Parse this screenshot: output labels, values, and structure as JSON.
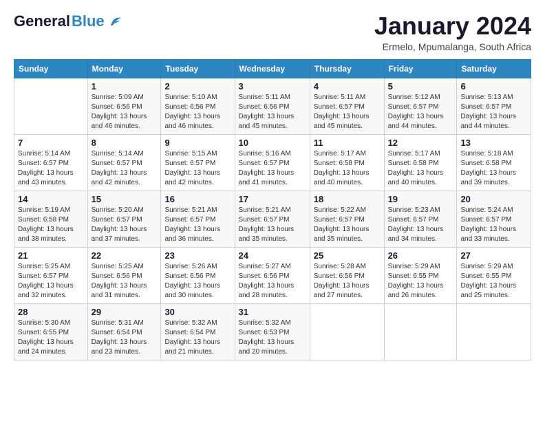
{
  "logo": {
    "general": "General",
    "blue": "Blue"
  },
  "header": {
    "month_title": "January 2024",
    "location": "Ermelo, Mpumalanga, South Africa"
  },
  "weekdays": [
    "Sunday",
    "Monday",
    "Tuesday",
    "Wednesday",
    "Thursday",
    "Friday",
    "Saturday"
  ],
  "weeks": [
    [
      {
        "day": "",
        "sunrise": "",
        "sunset": "",
        "daylight": ""
      },
      {
        "day": "1",
        "sunrise": "Sunrise: 5:09 AM",
        "sunset": "Sunset: 6:56 PM",
        "daylight": "Daylight: 13 hours and 46 minutes."
      },
      {
        "day": "2",
        "sunrise": "Sunrise: 5:10 AM",
        "sunset": "Sunset: 6:56 PM",
        "daylight": "Daylight: 13 hours and 46 minutes."
      },
      {
        "day": "3",
        "sunrise": "Sunrise: 5:11 AM",
        "sunset": "Sunset: 6:56 PM",
        "daylight": "Daylight: 13 hours and 45 minutes."
      },
      {
        "day": "4",
        "sunrise": "Sunrise: 5:11 AM",
        "sunset": "Sunset: 6:57 PM",
        "daylight": "Daylight: 13 hours and 45 minutes."
      },
      {
        "day": "5",
        "sunrise": "Sunrise: 5:12 AM",
        "sunset": "Sunset: 6:57 PM",
        "daylight": "Daylight: 13 hours and 44 minutes."
      },
      {
        "day": "6",
        "sunrise": "Sunrise: 5:13 AM",
        "sunset": "Sunset: 6:57 PM",
        "daylight": "Daylight: 13 hours and 44 minutes."
      }
    ],
    [
      {
        "day": "7",
        "sunrise": "Sunrise: 5:14 AM",
        "sunset": "Sunset: 6:57 PM",
        "daylight": "Daylight: 13 hours and 43 minutes."
      },
      {
        "day": "8",
        "sunrise": "Sunrise: 5:14 AM",
        "sunset": "Sunset: 6:57 PM",
        "daylight": "Daylight: 13 hours and 42 minutes."
      },
      {
        "day": "9",
        "sunrise": "Sunrise: 5:15 AM",
        "sunset": "Sunset: 6:57 PM",
        "daylight": "Daylight: 13 hours and 42 minutes."
      },
      {
        "day": "10",
        "sunrise": "Sunrise: 5:16 AM",
        "sunset": "Sunset: 6:57 PM",
        "daylight": "Daylight: 13 hours and 41 minutes."
      },
      {
        "day": "11",
        "sunrise": "Sunrise: 5:17 AM",
        "sunset": "Sunset: 6:58 PM",
        "daylight": "Daylight: 13 hours and 40 minutes."
      },
      {
        "day": "12",
        "sunrise": "Sunrise: 5:17 AM",
        "sunset": "Sunset: 6:58 PM",
        "daylight": "Daylight: 13 hours and 40 minutes."
      },
      {
        "day": "13",
        "sunrise": "Sunrise: 5:18 AM",
        "sunset": "Sunset: 6:58 PM",
        "daylight": "Daylight: 13 hours and 39 minutes."
      }
    ],
    [
      {
        "day": "14",
        "sunrise": "Sunrise: 5:19 AM",
        "sunset": "Sunset: 6:58 PM",
        "daylight": "Daylight: 13 hours and 38 minutes."
      },
      {
        "day": "15",
        "sunrise": "Sunrise: 5:20 AM",
        "sunset": "Sunset: 6:57 PM",
        "daylight": "Daylight: 13 hours and 37 minutes."
      },
      {
        "day": "16",
        "sunrise": "Sunrise: 5:21 AM",
        "sunset": "Sunset: 6:57 PM",
        "daylight": "Daylight: 13 hours and 36 minutes."
      },
      {
        "day": "17",
        "sunrise": "Sunrise: 5:21 AM",
        "sunset": "Sunset: 6:57 PM",
        "daylight": "Daylight: 13 hours and 35 minutes."
      },
      {
        "day": "18",
        "sunrise": "Sunrise: 5:22 AM",
        "sunset": "Sunset: 6:57 PM",
        "daylight": "Daylight: 13 hours and 35 minutes."
      },
      {
        "day": "19",
        "sunrise": "Sunrise: 5:23 AM",
        "sunset": "Sunset: 6:57 PM",
        "daylight": "Daylight: 13 hours and 34 minutes."
      },
      {
        "day": "20",
        "sunrise": "Sunrise: 5:24 AM",
        "sunset": "Sunset: 6:57 PM",
        "daylight": "Daylight: 13 hours and 33 minutes."
      }
    ],
    [
      {
        "day": "21",
        "sunrise": "Sunrise: 5:25 AM",
        "sunset": "Sunset: 6:57 PM",
        "daylight": "Daylight: 13 hours and 32 minutes."
      },
      {
        "day": "22",
        "sunrise": "Sunrise: 5:25 AM",
        "sunset": "Sunset: 6:56 PM",
        "daylight": "Daylight: 13 hours and 31 minutes."
      },
      {
        "day": "23",
        "sunrise": "Sunrise: 5:26 AM",
        "sunset": "Sunset: 6:56 PM",
        "daylight": "Daylight: 13 hours and 30 minutes."
      },
      {
        "day": "24",
        "sunrise": "Sunrise: 5:27 AM",
        "sunset": "Sunset: 6:56 PM",
        "daylight": "Daylight: 13 hours and 28 minutes."
      },
      {
        "day": "25",
        "sunrise": "Sunrise: 5:28 AM",
        "sunset": "Sunset: 6:56 PM",
        "daylight": "Daylight: 13 hours and 27 minutes."
      },
      {
        "day": "26",
        "sunrise": "Sunrise: 5:29 AM",
        "sunset": "Sunset: 6:55 PM",
        "daylight": "Daylight: 13 hours and 26 minutes."
      },
      {
        "day": "27",
        "sunrise": "Sunrise: 5:29 AM",
        "sunset": "Sunset: 6:55 PM",
        "daylight": "Daylight: 13 hours and 25 minutes."
      }
    ],
    [
      {
        "day": "28",
        "sunrise": "Sunrise: 5:30 AM",
        "sunset": "Sunset: 6:55 PM",
        "daylight": "Daylight: 13 hours and 24 minutes."
      },
      {
        "day": "29",
        "sunrise": "Sunrise: 5:31 AM",
        "sunset": "Sunset: 6:54 PM",
        "daylight": "Daylight: 13 hours and 23 minutes."
      },
      {
        "day": "30",
        "sunrise": "Sunrise: 5:32 AM",
        "sunset": "Sunset: 6:54 PM",
        "daylight": "Daylight: 13 hours and 21 minutes."
      },
      {
        "day": "31",
        "sunrise": "Sunrise: 5:32 AM",
        "sunset": "Sunset: 6:53 PM",
        "daylight": "Daylight: 13 hours and 20 minutes."
      },
      {
        "day": "",
        "sunrise": "",
        "sunset": "",
        "daylight": ""
      },
      {
        "day": "",
        "sunrise": "",
        "sunset": "",
        "daylight": ""
      },
      {
        "day": "",
        "sunrise": "",
        "sunset": "",
        "daylight": ""
      }
    ]
  ]
}
